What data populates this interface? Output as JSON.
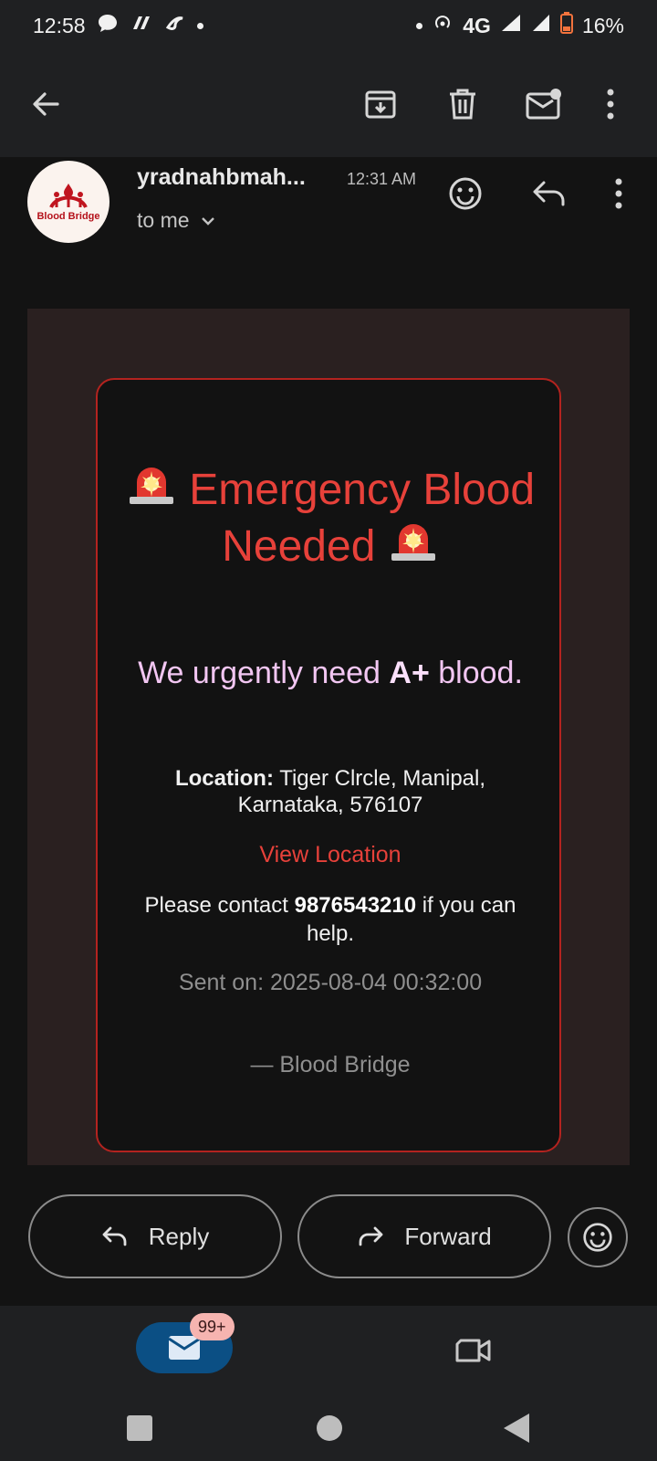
{
  "status_bar": {
    "time": "12:58",
    "network": "4G",
    "battery": "16%"
  },
  "sender": {
    "name": "yradnahbmah...",
    "time": "12:31 AM",
    "to": "to me",
    "avatar_brand": "Blood Bridge"
  },
  "email": {
    "headline": "Emergency Blood Needed",
    "urgent_prefix": "We urgently need ",
    "blood_type": "A+",
    "urgent_suffix": " blood.",
    "location_label": "Location:",
    "location_value": " Tiger Clrcle, Manipal, Karnataka, 576107",
    "view_location": "View Location",
    "contact_prefix": "Please contact ",
    "contact_phone": "9876543210",
    "contact_suffix": " if you can help.",
    "sent_on": "Sent on: 2025-08-04 00:32:00",
    "signature": "— Blood Bridge"
  },
  "actions": {
    "reply": "Reply",
    "forward": "Forward"
  },
  "bottom_nav": {
    "mail_badge": "99+"
  },
  "colors": {
    "accent_red": "#e7413a",
    "card_border": "#b3231f",
    "mail_pill": "#0b4f84"
  }
}
